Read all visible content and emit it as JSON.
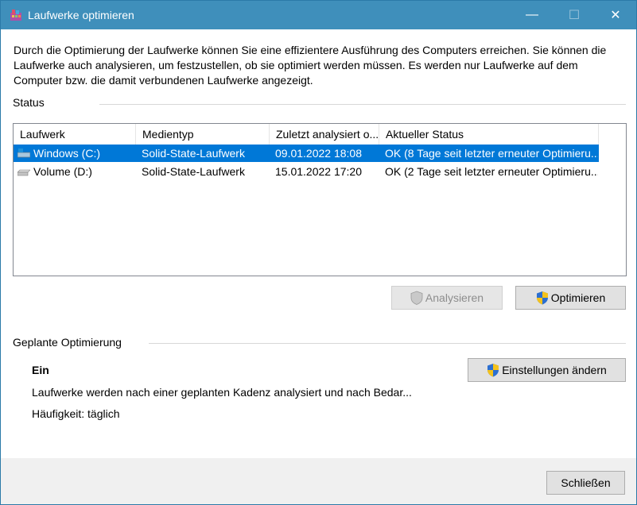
{
  "window": {
    "title": "Laufwerke optimieren",
    "minimize_symbol": "—",
    "maximize_symbol": "☐",
    "close_symbol": "✕"
  },
  "intro_text": "Durch die Optimierung der Laufwerke können Sie eine effizientere Ausführung des Computers erreichen. Sie können die Laufwerke auch analysieren, um festzustellen, ob sie optimiert werden müssen. Es werden nur Laufwerke auf dem Computer bzw. die damit verbundenen Laufwerke angezeigt.",
  "status_section": {
    "label": "Status"
  },
  "drive_list": {
    "columns": [
      "Laufwerk",
      "Medientyp",
      "Zuletzt analysiert o...",
      "Aktueller Status"
    ],
    "rows": [
      {
        "drive": "Windows (C:)",
        "media": "Solid-State-Laufwerk",
        "last_analyzed": "09.01.2022 18:08",
        "status": "OK (8 Tage seit letzter erneuter Optimieru...",
        "selected": true,
        "icon": "system-drive-icon"
      },
      {
        "drive": "Volume (D:)",
        "media": "Solid-State-Laufwerk",
        "last_analyzed": "15.01.2022 17:20",
        "status": "OK (2 Tage seit letzter erneuter Optimieru...",
        "selected": false,
        "icon": "drive-icon"
      }
    ]
  },
  "actions": {
    "analyze_label": "Analysieren",
    "optimize_label": "Optimieren",
    "analyze_enabled": false
  },
  "scheduled": {
    "label": "Geplante Optimierung",
    "state": "Ein",
    "description": "Laufwerke werden nach einer geplanten Kadenz analysiert und nach Bedar...",
    "frequency": "Häufigkeit: täglich",
    "settings_label": "Einstellungen ändern"
  },
  "footer": {
    "close_label": "Schließen"
  },
  "colors": {
    "titlebar": "#3f8fbb",
    "selection": "#0078d7"
  }
}
